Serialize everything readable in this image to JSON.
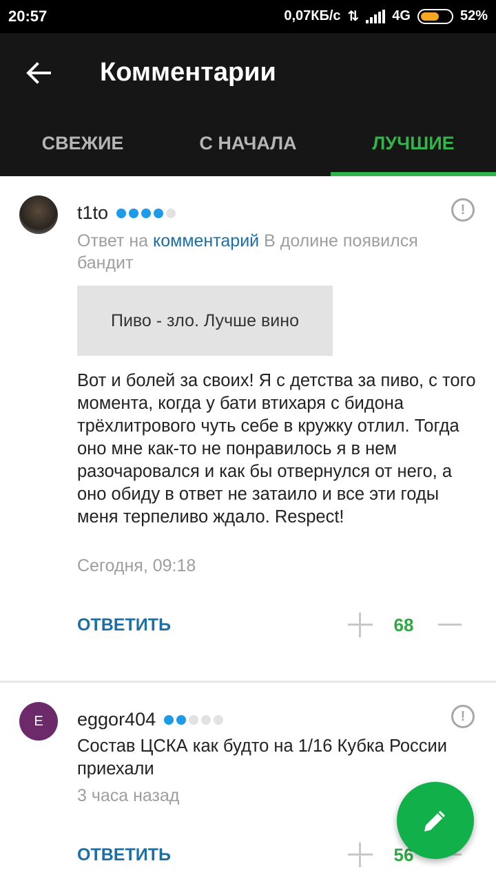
{
  "status": {
    "time": "20:57",
    "speed": "0,07КБ/с",
    "network": "4G",
    "battery": "52%",
    "battery_color": "#f5a623"
  },
  "appbar": {
    "back_icon": "arrow-left-icon",
    "title": "Комментарии"
  },
  "tabs": [
    {
      "label": "СВЕЖИЕ",
      "active": false
    },
    {
      "label": "С НАЧАЛА",
      "active": false
    },
    {
      "label": "ЛУЧШИЕ",
      "active": true
    }
  ],
  "comments": [
    {
      "author": "t1to",
      "level": 4,
      "level_max": 5,
      "reply_prefix": "Ответ на",
      "reply_link": "комментарий",
      "reply_rest": "В долине появился бандит",
      "quote": "Пиво - зло. Лучше вино",
      "text": "Вот и болей за своих! Я с детства за пиво, с того момента,  когда у бати втихаря с бидона трёхлитрового чуть себе в кружку отлил. Тогда оно мне как-то не понравилось я в нем разочаровался и как бы отвернулся от него, а оно обиду в ответ не затаило и все эти годы меня терпеливо ждало. Respect!",
      "date": "Сегодня, 09:18",
      "reply_label": "ОТВЕТИТЬ",
      "score": "68"
    },
    {
      "author": "eggor404",
      "avatar_letter": "E",
      "level": 2,
      "level_max": 5,
      "text": "Состав ЦСКА как будто на 1/16 Кубка России приехали",
      "date": "3 часа назад",
      "reply_label": "ОТВЕТИТЬ",
      "score": "56"
    }
  ],
  "fab": {
    "icon": "pencil-icon"
  },
  "colors": {
    "accent_green": "#2fb34a",
    "link_blue": "#1b6fa6",
    "dot_blue": "#1e9be8"
  }
}
